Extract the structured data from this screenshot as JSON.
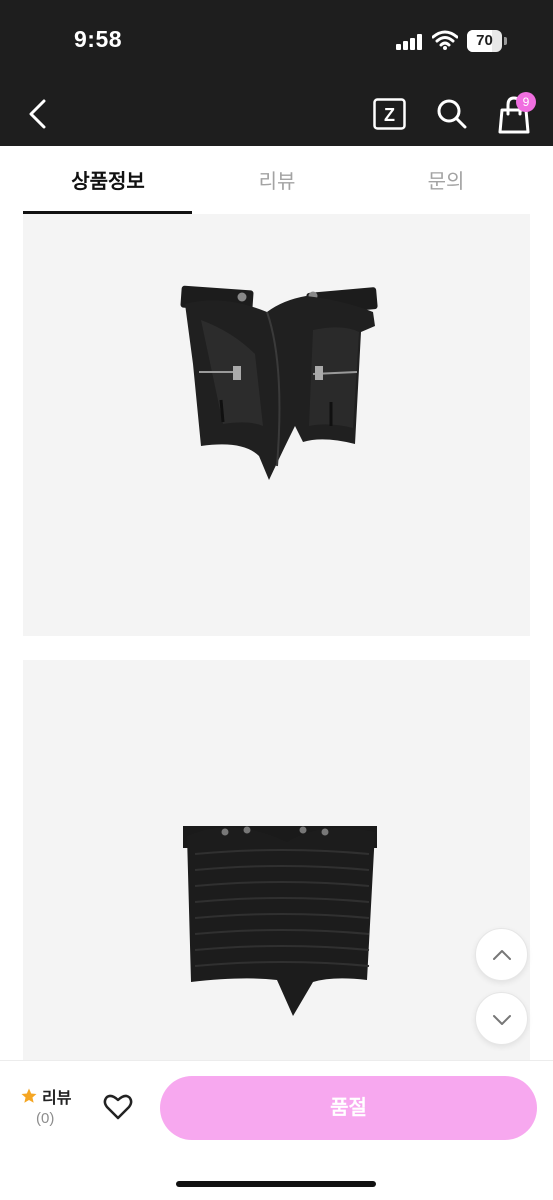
{
  "status_bar": {
    "time": "9:58",
    "battery": "70",
    "battery_level": 0.7,
    "icons": [
      "signal-icon",
      "wifi-icon",
      "battery-icon"
    ]
  },
  "header": {
    "icons": [
      "back-icon",
      "z-logo-icon",
      "search-icon",
      "shopping-bag-icon"
    ],
    "z_letter": "Z",
    "cart_badge": "9",
    "badge_color": "#f06fe0"
  },
  "tabs": [
    {
      "label": "상품정보",
      "active": true
    },
    {
      "label": "리뷰",
      "active": false
    },
    {
      "label": "문의",
      "active": false
    }
  ],
  "product_images": [
    {
      "name": "black-leather-corset-front"
    },
    {
      "name": "black-leather-corset-back"
    }
  ],
  "floating_buttons": [
    "scroll-up-icon",
    "scroll-down-icon"
  ],
  "bottom_bar": {
    "review_label": "리뷰",
    "review_count": "(0)",
    "buy_button_label": "품절",
    "accent_color": "#f7a8ef",
    "star_color": "#f5a623"
  }
}
